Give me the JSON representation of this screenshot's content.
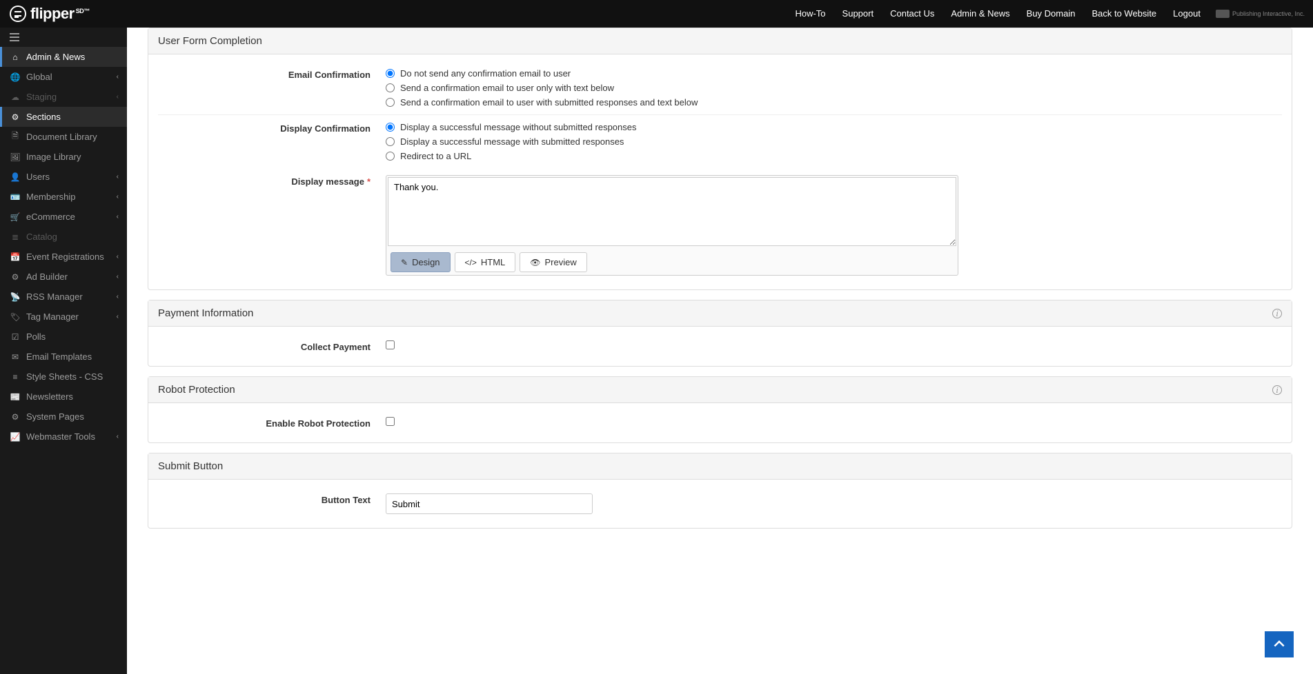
{
  "brand": {
    "name": "flipper",
    "suffix": "SD™"
  },
  "topnav": {
    "howto": "How-To",
    "support": "Support",
    "contact": "Contact Us",
    "adminnews": "Admin & News",
    "buydomain": "Buy Domain",
    "backtosite": "Back to Website",
    "logout": "Logout",
    "vendor": "Publishing Interactive, Inc."
  },
  "sidebar": {
    "items": [
      {
        "label": "Admin & News",
        "icon": "home",
        "active": true
      },
      {
        "label": "Global",
        "icon": "globe",
        "expandable": true
      },
      {
        "label": "Staging",
        "icon": "cloud",
        "expandable": true,
        "disabled": true
      },
      {
        "label": "Sections",
        "icon": "cog",
        "active": true
      },
      {
        "label": "Document Library",
        "icon": "file"
      },
      {
        "label": "Image Library",
        "icon": "image"
      },
      {
        "label": "Users",
        "icon": "user",
        "expandable": true
      },
      {
        "label": "Membership",
        "icon": "idcard",
        "expandable": true
      },
      {
        "label": "eCommerce",
        "icon": "cart",
        "expandable": true
      },
      {
        "label": "Catalog",
        "icon": "list",
        "disabled": true
      },
      {
        "label": "Event Registrations",
        "icon": "calendar",
        "expandable": true
      },
      {
        "label": "Ad Builder",
        "icon": "cogs",
        "expandable": true
      },
      {
        "label": "RSS Manager",
        "icon": "rss",
        "expandable": true
      },
      {
        "label": "Tag Manager",
        "icon": "tag",
        "expandable": true
      },
      {
        "label": "Polls",
        "icon": "check"
      },
      {
        "label": "Email Templates",
        "icon": "envelope"
      },
      {
        "label": "Style Sheets - CSS",
        "icon": "code"
      },
      {
        "label": "Newsletters",
        "icon": "news"
      },
      {
        "label": "System Pages",
        "icon": "gear"
      },
      {
        "label": "Webmaster Tools",
        "icon": "chart",
        "expandable": true
      }
    ]
  },
  "panels": {
    "userform": {
      "title": "User Form Completion",
      "emailConfirmLabel": "Email Confirmation",
      "emailOptions": [
        "Do not send any confirmation email to user",
        "Send a confirmation email to user only with text below",
        "Send a confirmation email to user with submitted responses and text below"
      ],
      "displayConfirmLabel": "Display Confirmation",
      "displayOptions": [
        "Display a successful message without submitted responses",
        "Display a successful message with submitted responses",
        "Redirect to a URL"
      ],
      "displayMessageLabel": "Display message",
      "displayMessageValue": "Thank you.",
      "tabs": {
        "design": "Design",
        "html": "HTML",
        "preview": "Preview"
      }
    },
    "payment": {
      "title": "Payment Information",
      "collectLabel": "Collect Payment"
    },
    "robot": {
      "title": "Robot Protection",
      "enableLabel": "Enable Robot Protection"
    },
    "submit": {
      "title": "Submit Button",
      "buttonTextLabel": "Button Text",
      "buttonTextValue": "Submit"
    }
  }
}
